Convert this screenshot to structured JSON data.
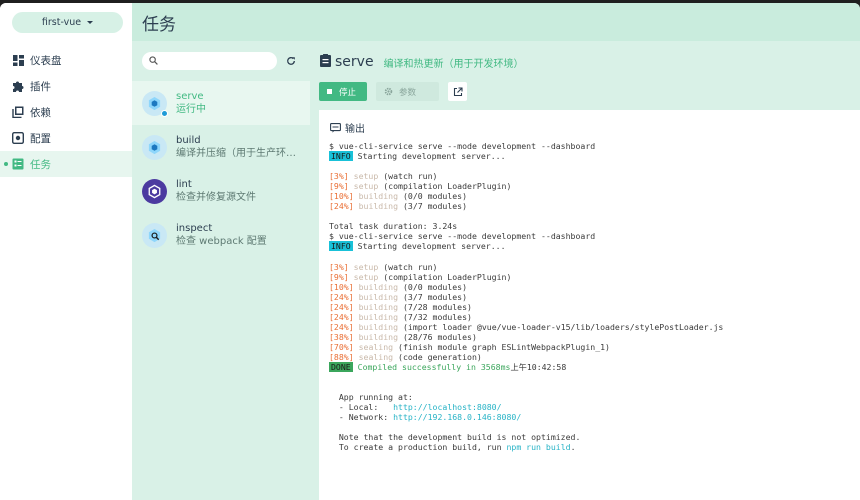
{
  "project": {
    "name": "first-vue"
  },
  "nav": [
    {
      "label": "仪表盘",
      "icon": "dashboard-icon",
      "active": false
    },
    {
      "label": "插件",
      "icon": "puzzle-icon",
      "active": false
    },
    {
      "label": "依赖",
      "icon": "library-icon",
      "active": false
    },
    {
      "label": "配置",
      "icon": "settings-icon",
      "active": false
    },
    {
      "label": "任务",
      "icon": "tasks-icon",
      "active": true
    }
  ],
  "header": {
    "title": "任务"
  },
  "task_list": {
    "search_placeholder": "",
    "tasks": [
      {
        "name": "serve",
        "desc": "运行中",
        "selected": true
      },
      {
        "name": "build",
        "desc": "编译并压缩（用于生产环境）",
        "selected": false
      },
      {
        "name": "lint",
        "desc": "检查并修复源文件",
        "selected": false
      },
      {
        "name": "inspect",
        "desc": "检查 webpack 配置",
        "selected": false
      }
    ]
  },
  "details": {
    "task_name": "serve",
    "task_desc": "编译和热更新（用于开发环境）",
    "stop_label": "停止",
    "params_label": "参数",
    "output_title": "输出"
  },
  "log": [
    "$ vue-cli-service serve --mode development --dashboard",
    "INFO|Starting development server...",
    "",
    "[3%]|setup|(watch run)",
    "[9%]|setup|(compilation LoaderPlugin)",
    "[10%]|building|(0/0 modules)",
    "[24%]|building|(3/7 modules)",
    "",
    "Total task duration: 3.24s",
    "$ vue-cli-service serve --mode development --dashboard",
    "INFO|Starting development server...",
    "",
    "[3%]|setup|(watch run)",
    "[9%]|setup|(compilation LoaderPlugin)",
    "[10%]|building|(0/0 modules)",
    "[24%]|building|(3/7 modules)",
    "[24%]|building|(7/28 modules)",
    "[24%]|building|(7/32 modules)",
    "[24%]|building|(import loader @vue/vue-loader-v15/lib/loaders/stylePostLoader.js",
    "[38%]|building|(28/76 modules)",
    "[70%]|sealing|(finish module graph ESLintWebpackPlugin_1)",
    "[88%]|sealing|(code generation)",
    "DONE|Compiled successfully in 3568ms|上午10:42:58",
    "",
    "",
    "  App running at:",
    "  - Local:   |http://localhost:8080/",
    "  - Network: |http://192.168.0.146:8080/",
    "",
    "  Note that the development build is not optimized.",
    "  To create a production build, run |npm run build|."
  ],
  "colors": {
    "accent": "#42b983",
    "header_bg": "#c9ecdd",
    "panel_bg": "#d9f1e7",
    "info": "#19c1d8",
    "progress": "#e96f35"
  }
}
